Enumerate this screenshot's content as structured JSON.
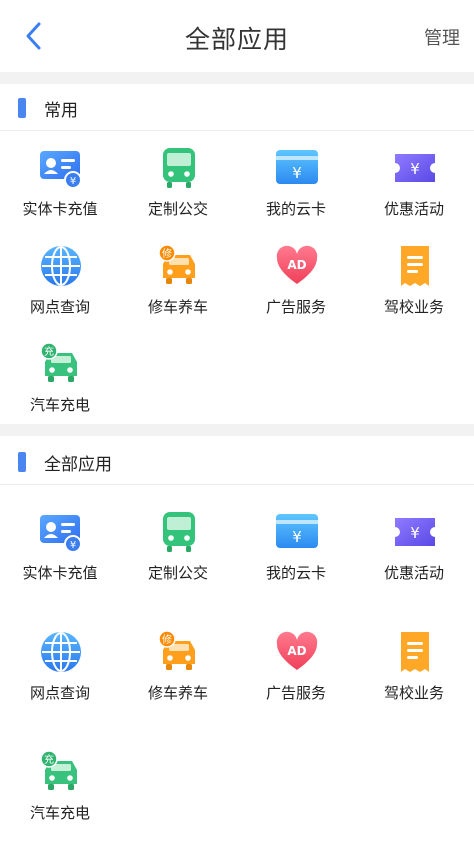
{
  "header": {
    "title": "全部应用",
    "manage": "管理"
  },
  "sections": [
    {
      "title": "常用",
      "items": [
        {
          "label": "实体卡充值",
          "icon": "id-card-yuan-icon"
        },
        {
          "label": "定制公交",
          "icon": "bus-icon"
        },
        {
          "label": "我的云卡",
          "icon": "cloud-card-icon"
        },
        {
          "label": "优惠活动",
          "icon": "coupon-ticket-icon"
        },
        {
          "label": "网点查询",
          "icon": "globe-icon"
        },
        {
          "label": "修车养车",
          "icon": "car-repair-icon"
        },
        {
          "label": "广告服务",
          "icon": "ad-heart-icon"
        },
        {
          "label": "驾校业务",
          "icon": "document-icon"
        },
        {
          "label": "汽车充电",
          "icon": "car-charge-icon"
        }
      ]
    },
    {
      "title": "全部应用",
      "items": [
        {
          "label": "实体卡充值",
          "icon": "id-card-yuan-icon"
        },
        {
          "label": "定制公交",
          "icon": "bus-icon"
        },
        {
          "label": "我的云卡",
          "icon": "cloud-card-icon"
        },
        {
          "label": "优惠活动",
          "icon": "coupon-ticket-icon"
        },
        {
          "label": "网点查询",
          "icon": "globe-icon"
        },
        {
          "label": "修车养车",
          "icon": "car-repair-icon"
        },
        {
          "label": "广告服务",
          "icon": "ad-heart-icon"
        },
        {
          "label": "驾校业务",
          "icon": "document-icon"
        },
        {
          "label": "汽车充电",
          "icon": "car-charge-icon"
        }
      ]
    }
  ],
  "icon_text": {
    "yuan": "¥",
    "repair": "修",
    "ad": "AD",
    "charge": "充"
  },
  "colors": {
    "accent": "#4b86f0",
    "gap": "#f2f2f2"
  }
}
